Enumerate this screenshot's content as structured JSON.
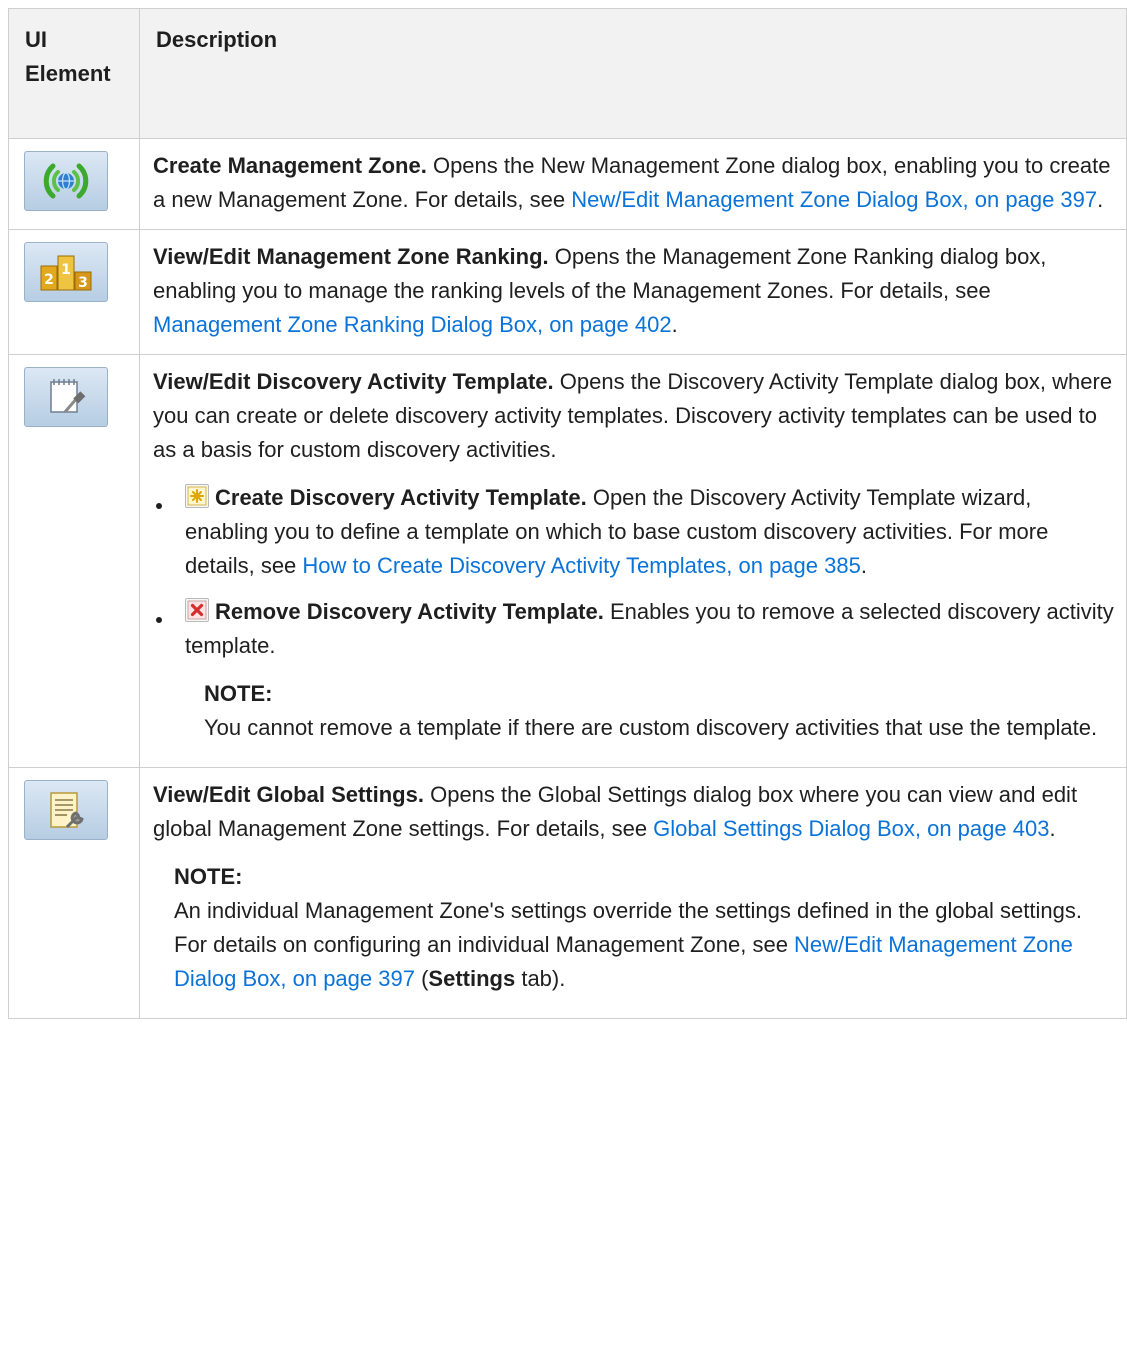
{
  "table": {
    "header": {
      "col1_line1": "UI",
      "col1_line2": "Element",
      "col2": "Description"
    },
    "rows": [
      {
        "icon": "management-zone-icon",
        "title": "Create Management Zone.",
        "text": " Opens the New Management Zone dialog box, enabling you to create a new Management Zone. For details, see ",
        "link": "New/Edit Management Zone Dialog Box, on page 397",
        "after": "."
      },
      {
        "icon": "ranking-icon",
        "title": "View/Edit Management Zone Ranking.",
        "text": " Opens the Management Zone Ranking dialog box, enabling you to manage the ranking levels of the Management Zones. For details, see ",
        "link": "Management Zone Ranking Dialog Box, on page 402",
        "after": "."
      },
      {
        "icon": "template-edit-icon",
        "title": "View/Edit Discovery Activity Template.",
        "text": " Opens the Discovery Activity Template dialog box, where you can create or delete discovery activity templates. Discovery activity templates can be used to as a basis for custom discovery activities.",
        "bullets": [
          {
            "icon": "new-star-icon",
            "title": "Create Discovery Activity Template.",
            "text": " Open the Discovery Activity Template wizard, enabling you to define a template on which to base custom discovery activities. For more details, see ",
            "link": "How to Create Discovery Activity Templates, on page 385",
            "after": "."
          },
          {
            "icon": "remove-x-icon",
            "title": "Remove Discovery Activity Template.",
            "text": " Enables you to remove a selected discovery activity template."
          }
        ],
        "note_title": "NOTE:",
        "note_text": "You cannot remove a template if there are custom discovery activities that use the template."
      },
      {
        "icon": "global-settings-icon",
        "title": "View/Edit Global Settings.",
        "text": " Opens the Global Settings dialog box where you can view and edit global Management Zone settings. For details, see ",
        "link": "Global Settings Dialog Box, on page 403",
        "after": ".",
        "note_title": "NOTE:",
        "note_text": "An individual Management Zone's settings override the settings defined in the global settings. For details on configuring an individual Management Zone, see ",
        "note_link": "New/Edit Management Zone Dialog Box, on page 397",
        "note_mid": " (",
        "note_bold": "Settings",
        "note_after": " tab)."
      }
    ]
  },
  "colors": {
    "link": "#0b73d8",
    "header_bg": "#f2f2f2",
    "border": "#cfcfcf"
  }
}
